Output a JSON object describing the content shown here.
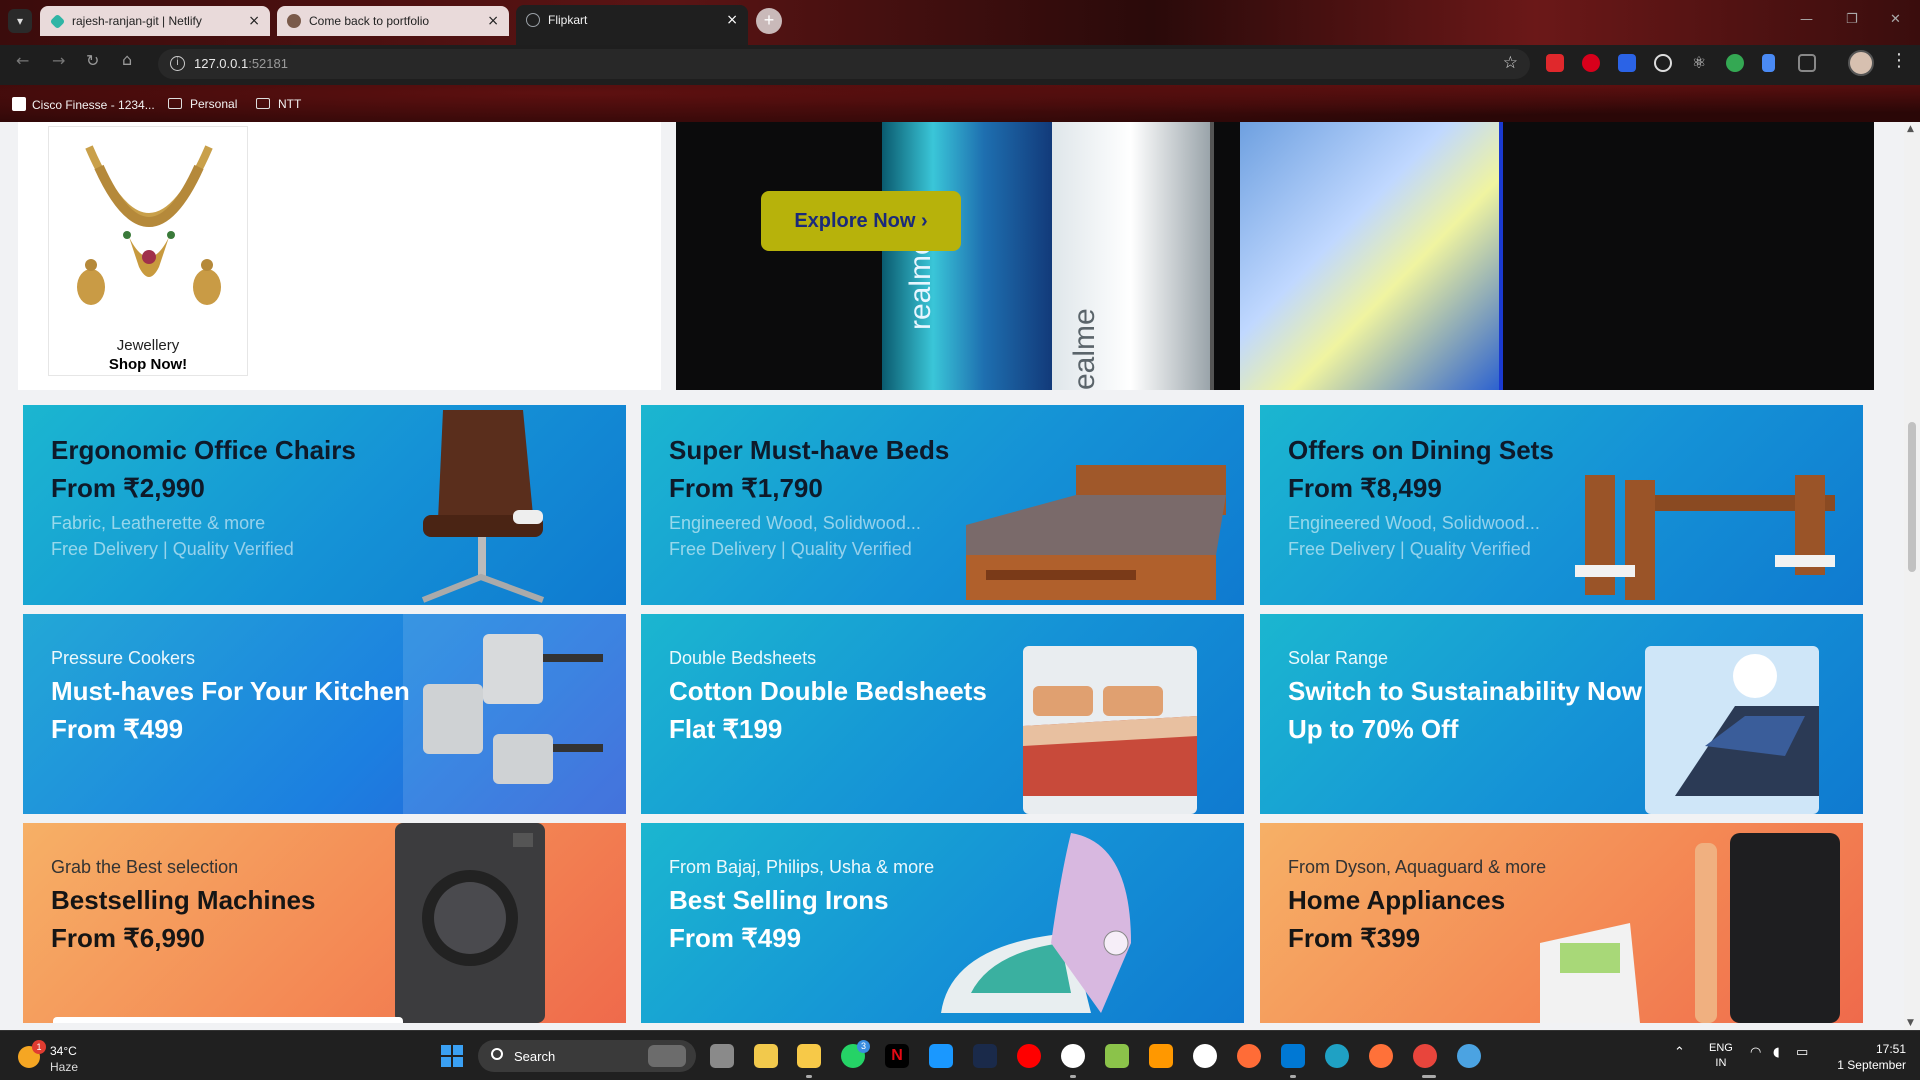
{
  "browser": {
    "tabs": [
      {
        "title": "rajesh-ranjan-git | Netlify",
        "active": false,
        "favicon_color": "#2fb5a5"
      },
      {
        "title": "Come back to portfolio",
        "active": false,
        "favicon_color": "#7a5a4a"
      },
      {
        "title": "Flipkart",
        "active": true,
        "favicon_color": "#9aa0a6"
      }
    ],
    "new_tab_glyph": "+",
    "url_host": "127.0.0.1",
    "url_port": ":52181",
    "bookmarks": [
      {
        "label": "Cisco Finesse - 1234...",
        "icon": "cisco-icon"
      },
      {
        "label": "Personal",
        "icon": "folder-icon"
      },
      {
        "label": "NTT",
        "icon": "folder-icon"
      }
    ],
    "extensions": [
      {
        "name": "adblock-plus-icon",
        "color": "#e0282c"
      },
      {
        "name": "adblock-icon",
        "color": "#d8001b"
      },
      {
        "name": "sortd-icon",
        "color": "#2b63e6"
      },
      {
        "name": "record-icon",
        "color": "#dddddd"
      },
      {
        "name": "react-devtools-icon",
        "color": "#dddddd"
      },
      {
        "name": "google-lens-icon",
        "color": "#34a853"
      },
      {
        "name": "docs-icon",
        "color": "#4a8af4"
      },
      {
        "name": "puzzle-icon",
        "color": "#888888"
      }
    ]
  },
  "page": {
    "jewellery": {
      "name": "Jewellery",
      "cta": "Shop Now!"
    },
    "hero": {
      "cta": "Explore Now ›",
      "phone_brand": "realme",
      "phone_brand_2": "ealme"
    },
    "banners": [
      {
        "title": "Ergonomic Office Chairs",
        "price": "From ₹2,990",
        "desc1": "Fabric, Leatherette & more",
        "desc2": "Free Delivery | Quality Verified",
        "theme": "blue",
        "image": "office-chair-image"
      },
      {
        "title": "Super Must-have Beds",
        "price": "From ₹1,790",
        "desc1": "Engineered Wood, Solidwood...",
        "desc2": "Free Delivery | Quality Verified",
        "theme": "blue",
        "image": "bed-image"
      },
      {
        "title": "Offers on Dining Sets",
        "price": "From ₹8,499",
        "desc1": "Engineered Wood, Solidwood...",
        "desc2": "Free Delivery | Quality Verified",
        "theme": "blue",
        "image": "dining-set-image"
      },
      {
        "sub": "Pressure Cookers",
        "title": "Must-haves For Your Kitchen",
        "price": "From ₹499",
        "theme": "blue2",
        "image": "pressure-cooker-image"
      },
      {
        "sub": "Double Bedsheets",
        "title": "Cotton Double Bedsheets",
        "price": "Flat ₹199",
        "theme": "blue",
        "image": "bedsheet-image"
      },
      {
        "sub": "Solar Range",
        "title": "Switch to Sustainability Now",
        "price": "Up to 70% Off",
        "theme": "blue",
        "image": "solar-panel-image"
      },
      {
        "sub": "Grab the Best selection",
        "title": "Bestselling Machines",
        "price": "From ₹6,990",
        "theme": "orange",
        "image": "washing-machine-image"
      },
      {
        "sub": "From Bajaj, Philips, Usha & more",
        "title": "Best Selling Irons",
        "price": "From ₹499",
        "theme": "blue",
        "image": "iron-image"
      },
      {
        "sub": "From Dyson, Aquaguard & more",
        "title": "Home Appliances",
        "price": "From ₹399",
        "theme": "orange",
        "image": "home-appliances-image"
      }
    ]
  },
  "taskbar": {
    "weather_temp": "34°C",
    "weather_cond": "Haze",
    "weather_badge": "1",
    "search_label": "Search",
    "whatsapp_badge": "3",
    "lang_line1": "ENG",
    "lang_line2": "IN",
    "time": "17:51",
    "date": "1 September"
  }
}
